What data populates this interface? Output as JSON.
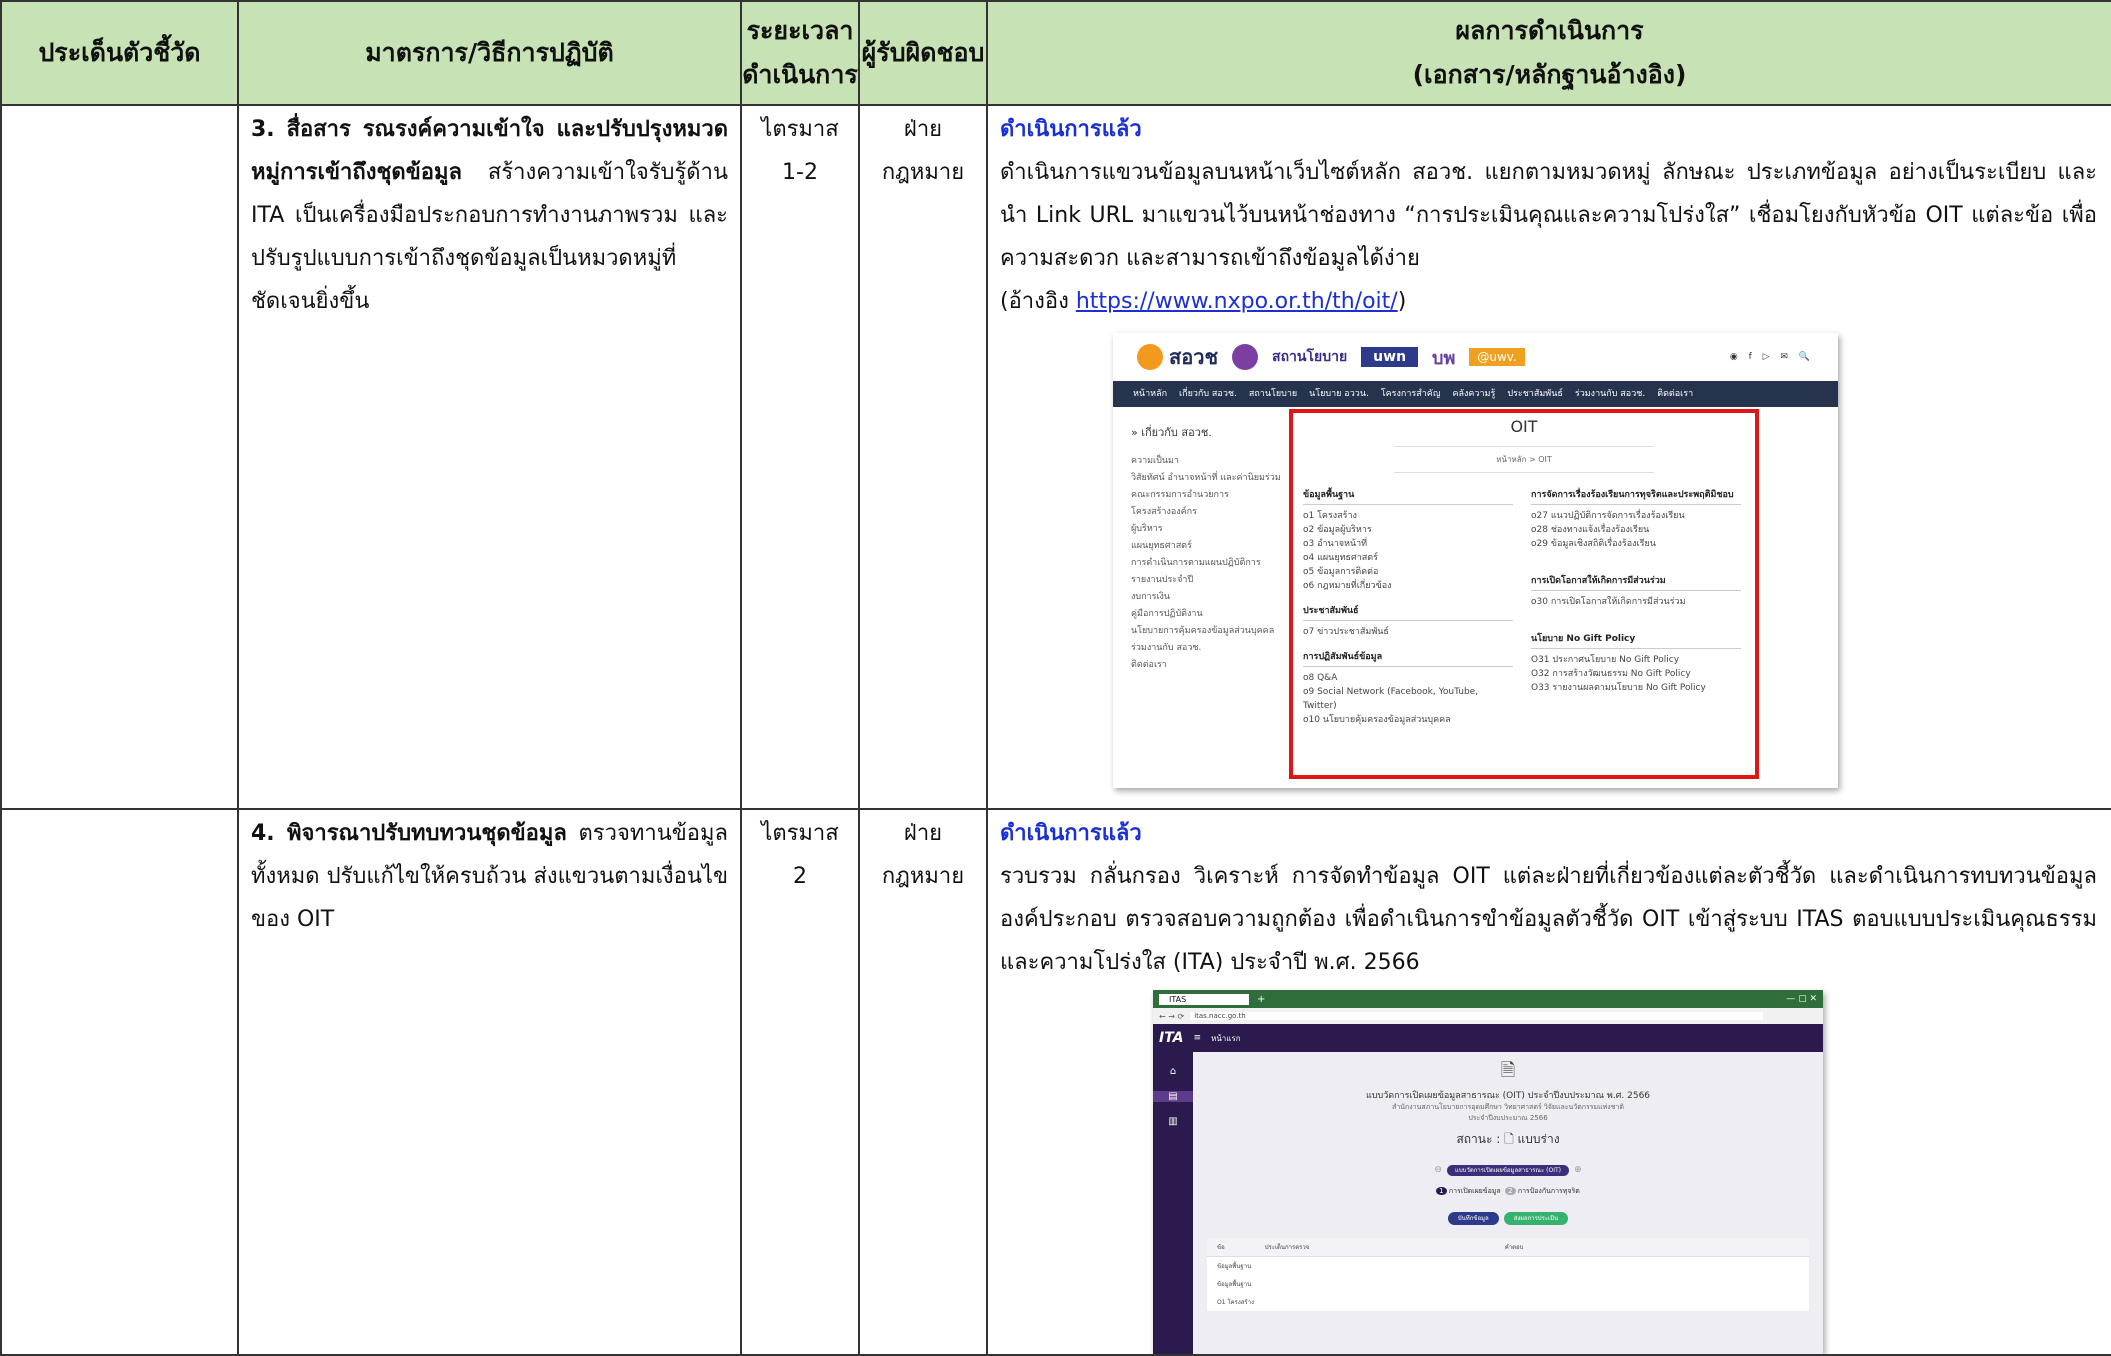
{
  "headers": {
    "col1": "ประเด็นตัวชี้วัด",
    "col2": "มาตรการ/วิธีการปฏิบัติ",
    "col3_line1": "ระยะเวลา",
    "col3_line2": "ดำเนินการ",
    "col4": "ผู้รับผิดชอบ",
    "col5_line1": "ผลการดำเนินการ",
    "col5_line2": "(เอกสาร/หลักฐานอ้างอิง)"
  },
  "rows": [
    {
      "measure_bold": "3. สื่อสาร รณรงค์ความเข้าใจ และปรับปรุงหมวดหมู่การเข้าถึงชุดข้อมูล",
      "measure_text": " สร้างความเข้าใจรับรู้ด้าน ITA เป็นเครื่องมือประกอบการทำงานภาพรวม และปรับรูปแบบการเข้าถึงชุดข้อมูลเป็นหมวดหมู่ที่ชัดเจนยิ่งขึ้น",
      "period": "ไตรมาส 1-2",
      "owner": "ฝ่ายกฎหมาย",
      "status": "ดำเนินการแล้ว",
      "result": "ดำเนินการแขวนข้อมูลบนหน้าเว็บไซต์หลัก สอวช. แยกตามหมวดหมู่ ลักษณะ ประเภทข้อมูล อย่างเป็นระเบียบ และนำ Link URL มาแขวนไว้บนหน้าช่องทาง “การประเมินคุณและความโปร่งใส” เชื่อมโยงกับหัวข้อ OIT แต่ละข้อ เพื่อความสะดวก และสามารถเข้าถึงข้อมูลได้ง่าย",
      "ref_prefix": "(อ้างอิง ",
      "ref_link": "https://www.nxpo.or.th/th/oit/",
      "ref_suffix": ")"
    },
    {
      "measure_bold": "4. พิจารณาปรับทบทวนชุดข้อมูล",
      "measure_text": " ตรวจทานข้อมูลทั้งหมด ปรับแก้ไขให้ครบถ้วน ส่งแขวนตามเงื่อนไขของ OIT",
      "period": "ไตรมาส 2",
      "owner": "ฝ่ายกฎหมาย",
      "status": "ดำเนินการแล้ว",
      "result": "รวบรวม กลั่นกรอง วิเคราะห์ การจัดทำข้อมูล OIT แต่ละฝ่ายที่เกี่ยวข้องแต่ละตัวชี้วัด และดำเนินการทบทวนข้อมูล องค์ประกอบ ตรวจสอบความถูกต้อง เพื่อดำเนินการขำข้อมูลตัวชี้วัด OIT เข้าสู่ระบบ ITAS ตอบแบบประเมินคุณธรรมและความโปร่งใส (ITA) ประจำปี พ.ศ. 2566"
    }
  ],
  "screenshot1": {
    "logo": "สอวช",
    "agency": "สถานโยบาย",
    "badge1": "uwn",
    "badge2": "@uwv.",
    "nav": [
      "หน้าหลัก",
      "เกี่ยวกับ สอวช.",
      "สถานโยบาย",
      "นโยบาย อววน.",
      "โครงการสำคัญ",
      "คลังความรู้",
      "ประชาสัมพันธ์",
      "ร่วมงานกับ สอวช.",
      "ติดต่อเรา"
    ],
    "sidebar_title": "» เกี่ยวกับ สอวช.",
    "sidebar_items": [
      "ความเป็นมา",
      "วิสัยทัศน์ อำนาจหน้าที่ และค่านิยมร่วม",
      "คณะกรรมการอำนวยการ",
      "โครงสร้างองค์กร",
      "ผู้บริหาร",
      "แผนยุทธศาสตร์",
      "การดำเนินการตามแผนปฏิบัติการ",
      "รายงานประจำปี",
      "งบการเงิน",
      "คู่มือการปฏิบัติงาน",
      "นโยบายการคุ้มครองข้อมูลส่วนบุคคล",
      "ร่วมงานกับ สอวช.",
      "ติดต่อเรา"
    ],
    "page_title": "OIT",
    "breadcrumb": "หน้าหลัก > OIT",
    "sections_left": [
      {
        "title": "ข้อมูลพื้นฐาน",
        "items": [
          "o1 โครงสร้าง",
          "o2 ข้อมูลผู้บริหาร",
          "o3 อำนาจหน้าที่",
          "o4 แผนยุทธศาสตร์",
          "o5 ข้อมูลการติดต่อ",
          "o6 กฎหมายที่เกี่ยวข้อง"
        ]
      },
      {
        "title": "ประชาสัมพันธ์",
        "items": [
          "o7 ข่าวประชาสัมพันธ์"
        ]
      },
      {
        "title": "การปฏิสัมพันธ์ข้อมูล",
        "items": [
          "o8 Q&A",
          "o9 Social Network (Facebook, YouTube, Twitter)",
          "o10 นโยบายคุ้มครองข้อมูลส่วนบุคคล"
        ]
      }
    ],
    "sections_right": [
      {
        "title": "การจัดการเรื่องร้องเรียนการทุจริตและประพฤติมิชอบ",
        "items": [
          "o27 แนวปฏิบัติการจัดการเรื่องร้องเรียน",
          "o28 ช่องทางแจ้งเรื่องร้องเรียน",
          "o29 ข้อมูลเชิงสถิติเรื่องร้องเรียน"
        ]
      },
      {
        "title": "การเปิดโอกาสให้เกิดการมีส่วนร่วม",
        "items": [
          "o30 การเปิดโอกาสให้เกิดการมีส่วนร่วม"
        ]
      },
      {
        "title": "นโยบาย No Gift Policy",
        "items": [
          "O31 ประกาศนโยบาย No Gift Policy",
          "O32 การสร้างวัฒนธรรม No Gift Policy",
          "O33 รายงานผลตามนโยบาย No Gift Policy"
        ]
      }
    ]
  },
  "screenshot2": {
    "tab_title": "ITAS",
    "url": "itas.nacc.go.th",
    "app_logo": "ITA",
    "menu_label": "หน้าแรก",
    "form_title": "แบบวัดการเปิดเผยข้อมูลสาธารณะ (OIT) ประจำปีงบประมาณ พ.ศ. 2566",
    "form_subtitle": "สำนักงานสภานโยบายการอุดมศึกษา วิทยาศาสตร์ วิจัยและนวัตกรรมแห่งชาติ",
    "form_year": "ประจำปีงบประมาณ 2566",
    "status_label": "สถานะ : 🗋 แบบร่าง",
    "chip": "แบบวัดการเปิดเผยข้อมูลสาธารณะ (OIT)",
    "step1": "การเปิดเผยข้อมูล",
    "step2": "การป้องกันการทุจริต",
    "btn_save": "บันทึกข้อมูล",
    "btn_send": "ส่งผลการประเมิน",
    "table_col1": "ข้อ",
    "table_col2": "ประเด็นการตรวจ",
    "table_col3": "คำตอบ",
    "table_rows": [
      "ข้อมูลพื้นฐาน",
      "ข้อมูลพื้นฐาน",
      "O1 โครงสร้าง"
    ]
  }
}
